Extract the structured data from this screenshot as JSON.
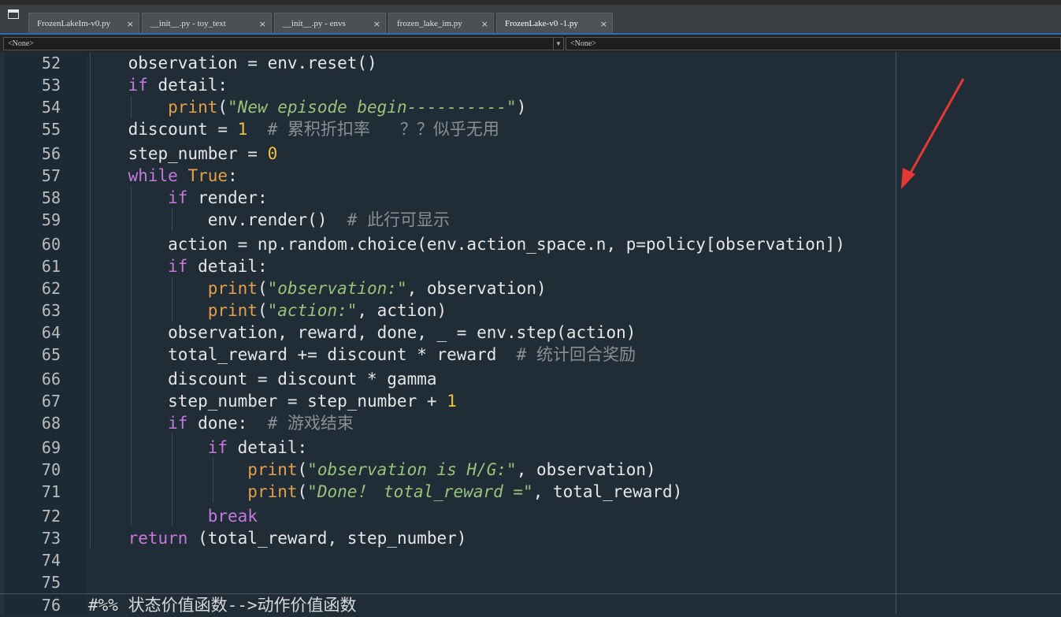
{
  "tabs": [
    {
      "label": "FrozenLakeIm-v0.py",
      "close": "×"
    },
    {
      "label": "__init__.py - toy_text",
      "close": "×"
    },
    {
      "label": "__init__.py - envs",
      "close": "×"
    },
    {
      "label": "frozen_lake_im.py",
      "close": "×"
    },
    {
      "label": "FrozenLake-v0 -1.py",
      "close": "×",
      "active": true
    }
  ],
  "navbar": {
    "left_combo": "<None>",
    "right_combo": "<None>"
  },
  "code_lines": [
    {
      "num": "52",
      "text": "    observation = env.reset()"
    },
    {
      "num": "53",
      "text": "    if detail:"
    },
    {
      "num": "54",
      "text": "        print(\"New episode begin----------\")"
    },
    {
      "num": "55",
      "text": "    discount = 1  # 累积折扣率   ？？似乎无用"
    },
    {
      "num": "56",
      "text": "    step_number = 0"
    },
    {
      "num": "57",
      "text": "    while True:"
    },
    {
      "num": "58",
      "text": "        if render:"
    },
    {
      "num": "59",
      "text": "            env.render()  # 此行可显示"
    },
    {
      "num": "60",
      "text": "        action = np.random.choice(env.action_space.n, p=policy[observation])"
    },
    {
      "num": "61",
      "text": "        if detail:"
    },
    {
      "num": "62",
      "text": "            print(\"observation:\", observation)"
    },
    {
      "num": "63",
      "text": "            print(\"action:\", action)"
    },
    {
      "num": "64",
      "text": "        observation, reward, done, _ = env.step(action)"
    },
    {
      "num": "65",
      "text": "        total_reward += discount * reward  # 统计回合奖励"
    },
    {
      "num": "66",
      "text": "        discount = discount * gamma"
    },
    {
      "num": "67",
      "text": "        step_number = step_number + 1"
    },
    {
      "num": "68",
      "text": "        if done:  # 游戏结束"
    },
    {
      "num": "69",
      "text": "            if detail:"
    },
    {
      "num": "70",
      "text": "                print(\"observation is H/G:\", observation)"
    },
    {
      "num": "71",
      "text": "                print(\"Done！ total_reward =\", total_reward)"
    },
    {
      "num": "72",
      "text": "            break"
    },
    {
      "num": "73",
      "text": "    return (total_reward, step_number)"
    },
    {
      "num": "74",
      "text": ""
    },
    {
      "num": "75",
      "text": ""
    },
    {
      "num": "76",
      "text": "#%% 状态价值函数-->动作价值函数"
    }
  ],
  "colors": {
    "keyword": "#c678dd",
    "builtin": "#e5a04a",
    "string": "#98c379",
    "number": "#f0c040",
    "comment": "#8a8f94",
    "annotation_arrow": "#e53935"
  },
  "icons": {
    "window": "window-icon",
    "close": "close-icon",
    "arrow": "annotation-arrow"
  }
}
